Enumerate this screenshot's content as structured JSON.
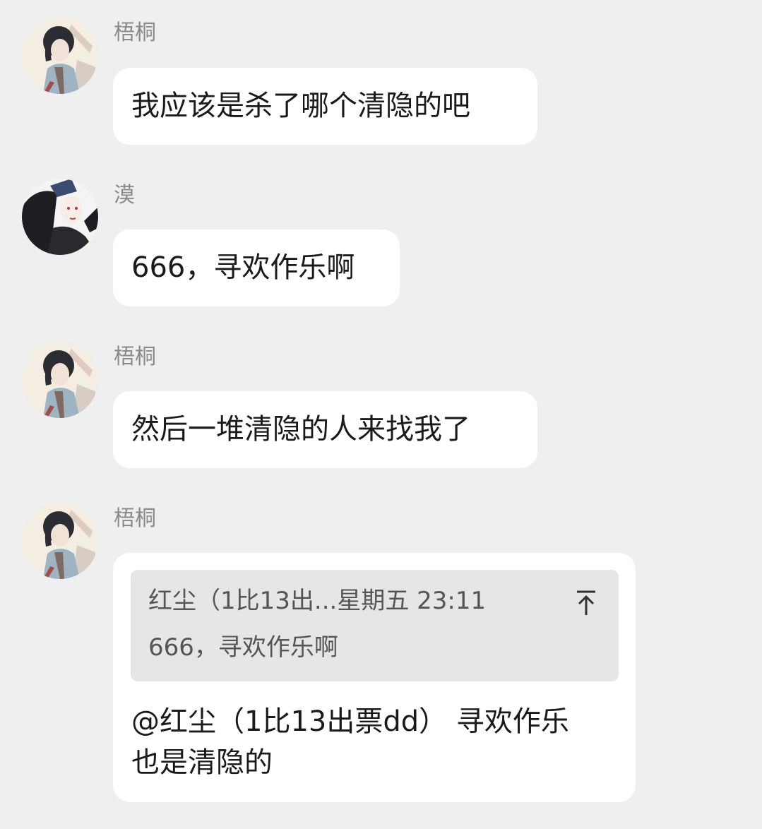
{
  "messages": [
    {
      "sender": "梧桐",
      "avatar": "wutong-avatar-icon",
      "text": "我应该是杀了哪个清隐的吧"
    },
    {
      "sender": "漠",
      "avatar": "mo-avatar-icon",
      "text": "666，寻欢作乐啊"
    },
    {
      "sender": "梧桐",
      "avatar": "wutong-avatar-icon",
      "text": "然后一堆清隐的人来找我了"
    },
    {
      "sender": "梧桐",
      "avatar": "wutong-avatar-icon",
      "quote": {
        "header": "红尘（1比13出...星期五 23:11",
        "body": "666，寻欢作乐啊",
        "jump_icon": "jump-to-original-icon"
      },
      "text_line1": "@红尘（1比13出票dd） 寻欢作乐",
      "text_line2": "也是清隐的"
    }
  ]
}
